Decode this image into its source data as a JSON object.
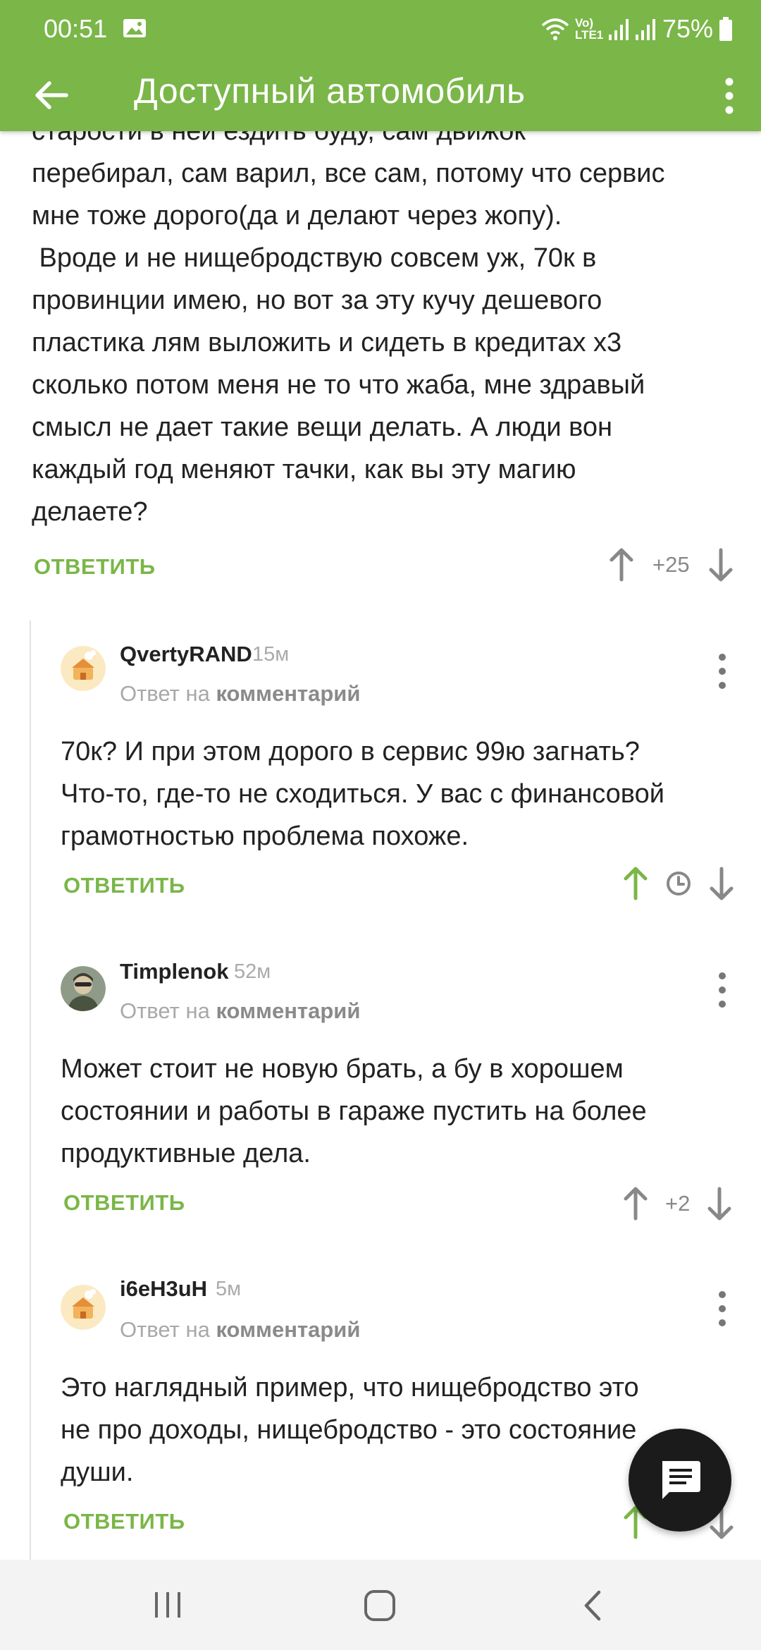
{
  "status_bar": {
    "time": "00:51",
    "network": "Vo) LTE1",
    "battery": "75%"
  },
  "app_bar": {
    "title": "Доступный автомобиль"
  },
  "top_comment": {
    "lines": [
      "старости в ней ездить буду, сам движок",
      "перебирал, сам варил, все сам, потому что сервис",
      "мне тоже дорого(да и делают через жопу).",
      " Вроде и не нищебродствую совсем уж, 70к в",
      "провинции имею, но вот за эту кучу дешевого",
      "пластика лям выложить и сидеть в кредитах х3",
      "сколько потом меня не то что жаба, мне здравый",
      "смысл не дает такие вещи делать. А люди вон",
      "каждый год меняют тачки, как вы эту магию",
      "делаете?"
    ],
    "reply_label": "ОТВЕТИТЬ",
    "score": "+25"
  },
  "comments": [
    {
      "author": "QvertyRAND",
      "ago": "15м",
      "reply_to_prefix": "Ответ на",
      "reply_to_link": "комментарий",
      "lines": [
        "70к? И при этом дорого в сервис 99ю загнать?",
        "Что-то, где-то не сходиться. У вас с финансовой",
        "грамотностью проблема похоже."
      ],
      "reply_label": "ОТВЕТИТЬ",
      "score": "",
      "voted_up": true
    },
    {
      "author": "Timplenok",
      "ago": "52м",
      "reply_to_prefix": "Ответ на",
      "reply_to_link": "комментарий",
      "lines": [
        "Может стоит не новую брать, а бу в хорошем",
        "состоянии и работы в гараже пустить на более",
        "продуктивные дела."
      ],
      "reply_label": "ОТВЕТИТЬ",
      "score": "+2",
      "voted_up": false
    },
    {
      "author": "i6eH3uH",
      "ago": "5м",
      "reply_to_prefix": "Ответ на",
      "reply_to_link": "комментарий",
      "lines": [
        "Это наглядный пример, что нищебродство это",
        "не про доходы, нищебродство - это состояние",
        "души."
      ],
      "reply_label": "ОТВЕТИТЬ",
      "score": "",
      "voted_up": true
    }
  ],
  "colors": {
    "accent": "#7ab648",
    "fab": "#1b1b1b"
  },
  "icons": {
    "back": "arrow-left-icon",
    "more": "more-vertical-icon",
    "upvote": "arrow-up-icon",
    "downvote": "arrow-down-icon",
    "pending": "clock-icon",
    "fab": "chat-icon",
    "nav_recent": "recent-apps-icon",
    "nav_home": "home-icon",
    "nav_back": "nav-back-icon"
  }
}
